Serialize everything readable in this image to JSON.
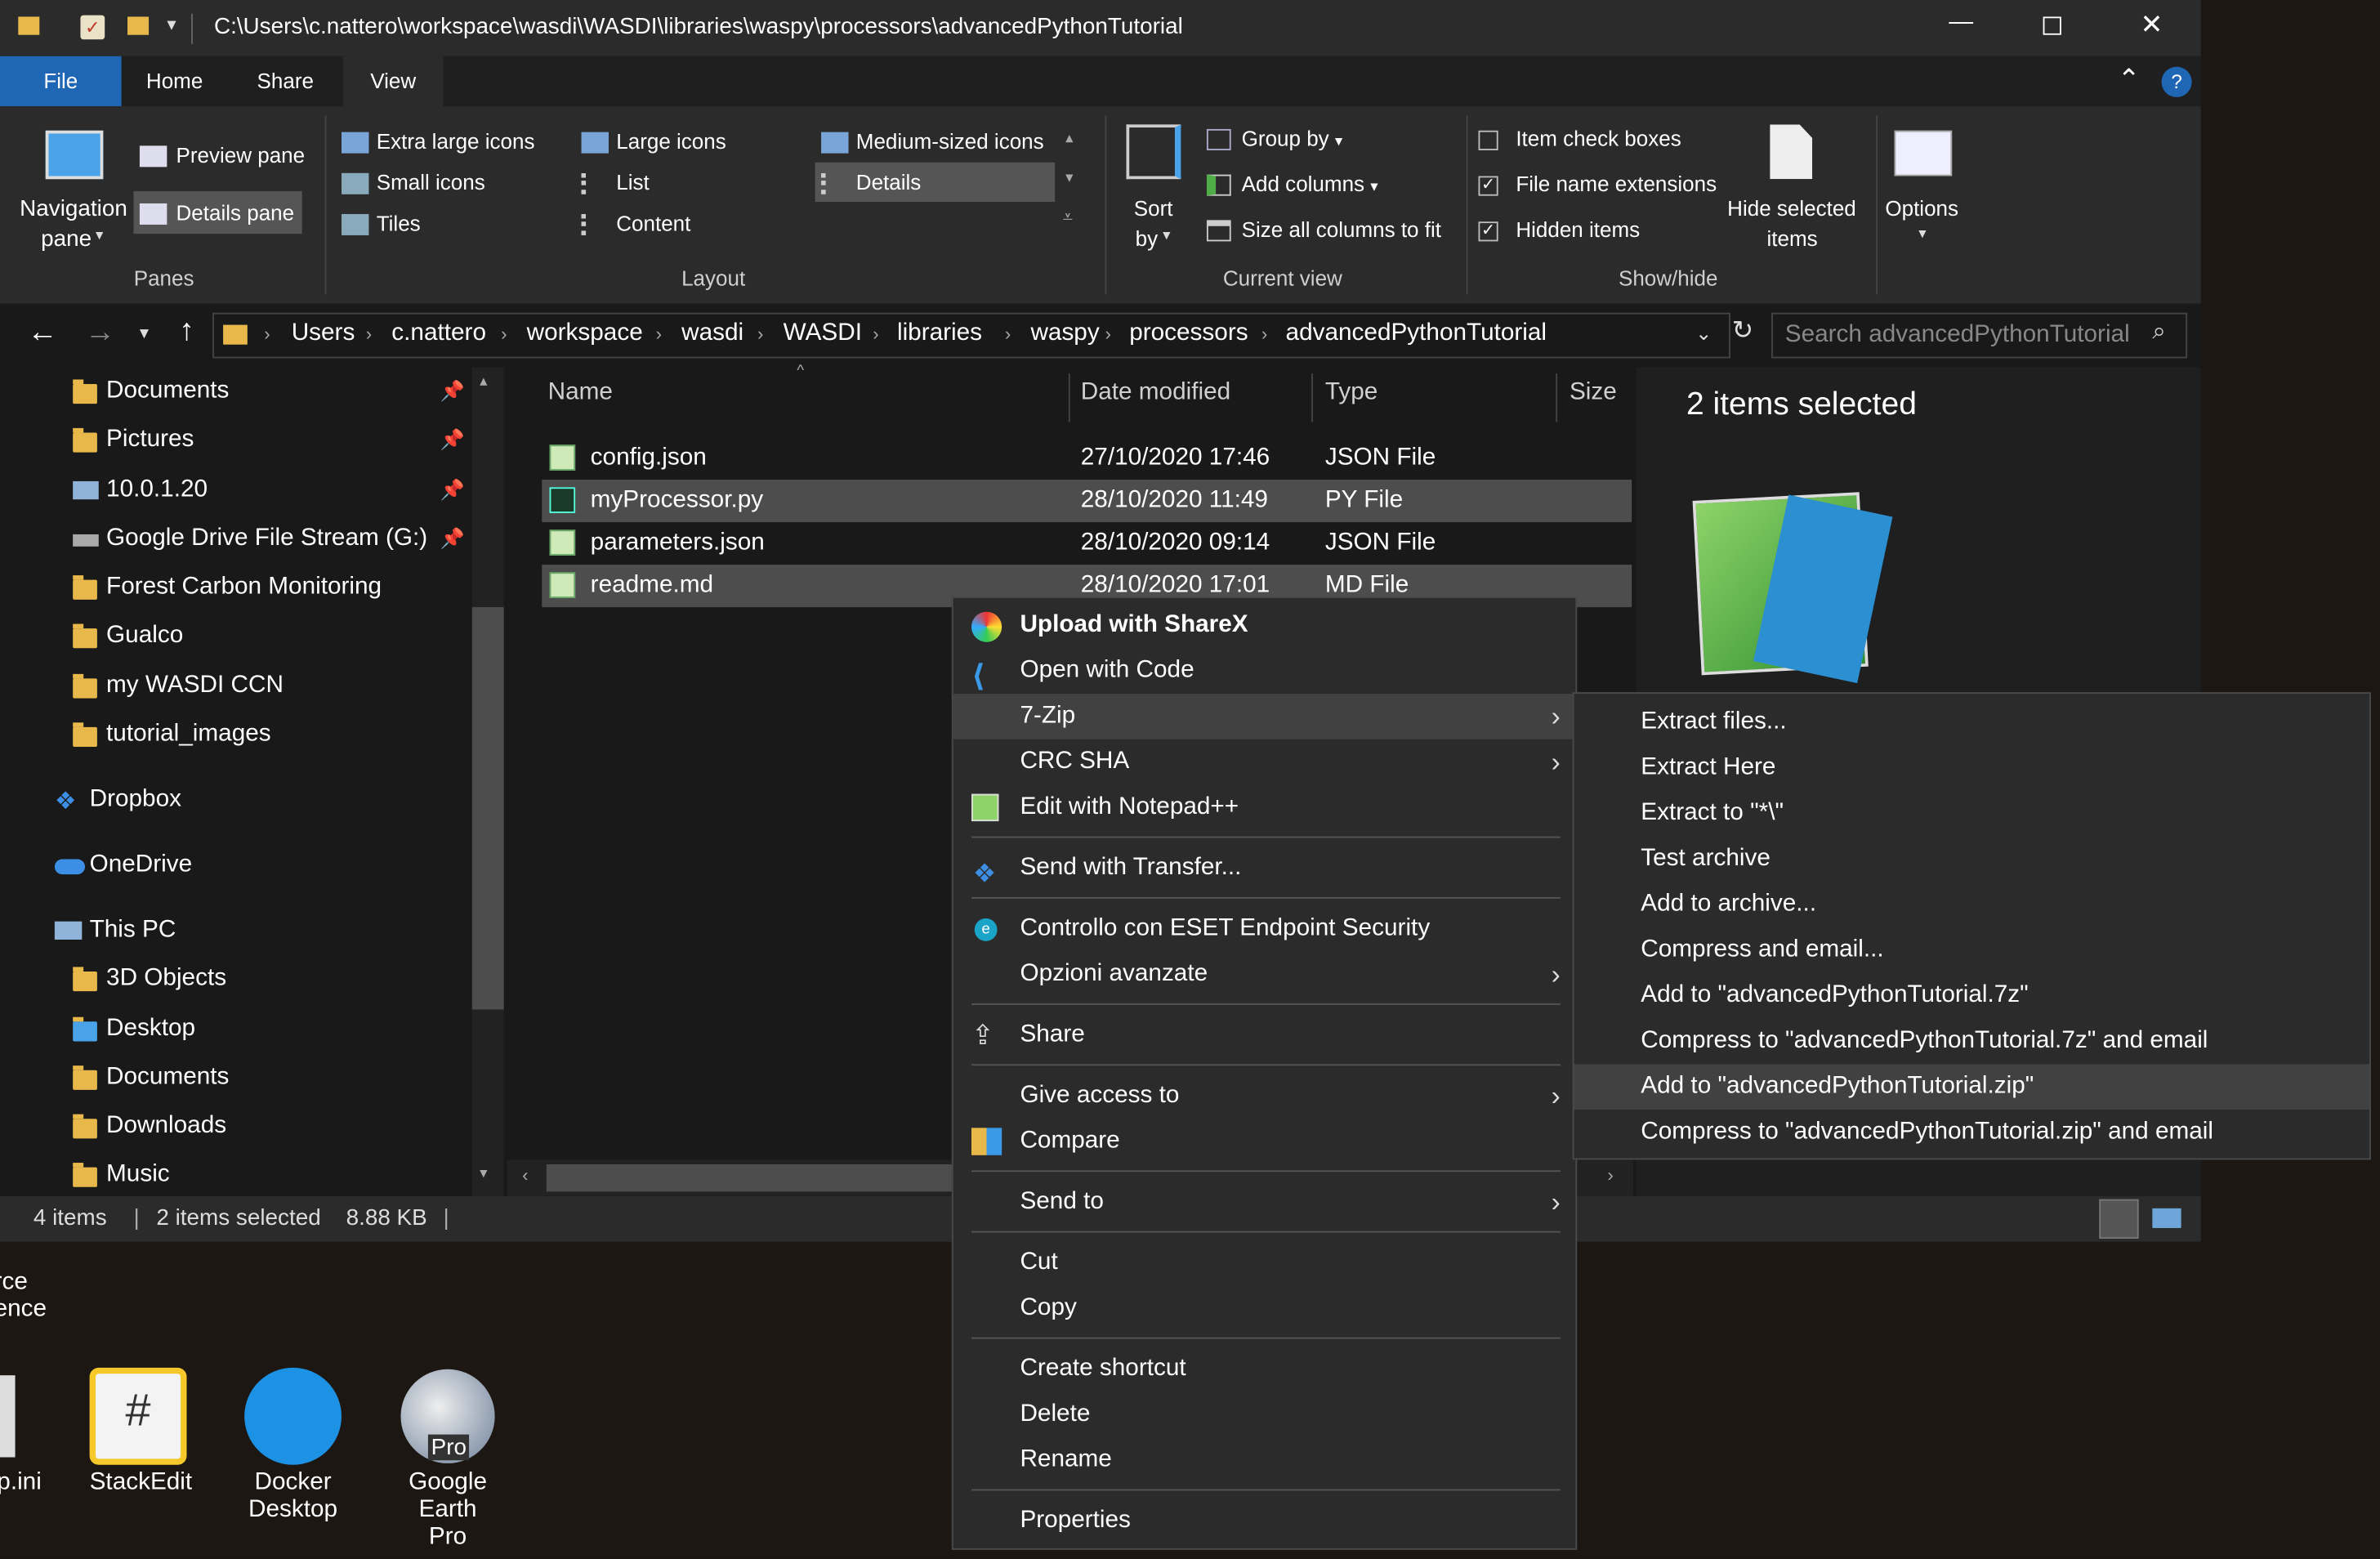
{
  "title_path": "C:\\Users\\c.nattero\\workspace\\wasdi\\WASDI\\libraries\\waspy\\processors\\advancedPythonTutorial",
  "tabs": [
    "File",
    "Home",
    "Share",
    "View"
  ],
  "ribbon": {
    "panes": {
      "nav": "Navigation",
      "nav2": "pane",
      "preview": "Preview pane",
      "details": "Details pane",
      "group": "Panes"
    },
    "layout": {
      "xl": "Extra large icons",
      "large": "Large icons",
      "medium": "Medium-sized icons",
      "small": "Small icons",
      "list": "List",
      "details": "Details",
      "tiles": "Tiles",
      "content": "Content",
      "group": "Layout"
    },
    "current": {
      "sort": "Sort",
      "by": "by",
      "groupby": "Group by",
      "addcols": "Add columns",
      "sizeall": "Size all columns to fit",
      "group": "Current view"
    },
    "showhide": {
      "checkboxes": "Item check boxes",
      "extensions": "File name extensions",
      "hidden": "Hidden items",
      "hide1": "Hide selected",
      "hide2": "items",
      "group": "Show/hide"
    },
    "options": "Options"
  },
  "breadcrumbs": [
    "Users",
    "c.nattero",
    "workspace",
    "wasdi",
    "WASDI",
    "libraries",
    "waspy",
    "processors",
    "advancedPythonTutorial"
  ],
  "search_placeholder": "Search advancedPythonTutorial",
  "nav": [
    "Documents",
    "Pictures",
    "10.0.1.20",
    "Google Drive File Stream (G:)",
    "Forest Carbon Monitoring",
    "Gualco",
    "my WASDI CCN",
    "tutorial_images",
    "Dropbox",
    "OneDrive",
    "This PC",
    "3D Objects",
    "Desktop",
    "Documents",
    "Downloads",
    "Music"
  ],
  "columns": {
    "name": "Name",
    "date": "Date modified",
    "type": "Type",
    "size": "Size"
  },
  "files": [
    {
      "name": "config.json",
      "date": "27/10/2020 17:46",
      "type": "JSON File"
    },
    {
      "name": "myProcessor.py",
      "date": "28/10/2020 11:49",
      "type": "PY File"
    },
    {
      "name": "parameters.json",
      "date": "28/10/2020 09:14",
      "type": "JSON File"
    },
    {
      "name": "readme.md",
      "date": "28/10/2020 17:01",
      "type": "MD File"
    }
  ],
  "preview_text": "2 items selected",
  "status": {
    "count": "4 items",
    "selected": "2 items selected",
    "size": "8.88 KB"
  },
  "context_menu": [
    "Upload with ShareX",
    "Open with Code",
    "7-Zip",
    "CRC SHA",
    "Edit with Notepad++",
    "Send with Transfer...",
    "Controllo con ESET Endpoint Security",
    "Opzioni avanzate",
    "Share",
    "Give access to",
    "Compare",
    "Send to",
    "Cut",
    "Copy",
    "Create shortcut",
    "Delete",
    "Rename",
    "Properties"
  ],
  "submenu": [
    "Extract files...",
    "Extract Here",
    "Extract to \"*\\\"",
    "Test archive",
    "Add to archive...",
    "Compress and email...",
    "Add to \"advancedPythonTutorial.7z\"",
    "Compress to \"advancedPythonTutorial.7z\" and email",
    "Add to \"advancedPythonTutorial.zip\"",
    "Compress to \"advancedPythonTutorial.zip\" and email"
  ],
  "desktop": {
    "left1": "rce",
    "left2": "ence",
    "left3": "p.ini",
    "stackedit": "StackEdit",
    "docker1": "Docker",
    "docker2": "Desktop",
    "gearth1": "Google Earth",
    "gearth2": "Pro",
    "pro_badge": "Pro"
  },
  "colors": {
    "ribbon": "#2b2b2b",
    "selected_row": "#4d4d4d",
    "menu": "#2b2b2b",
    "accent": "#0078d7"
  }
}
